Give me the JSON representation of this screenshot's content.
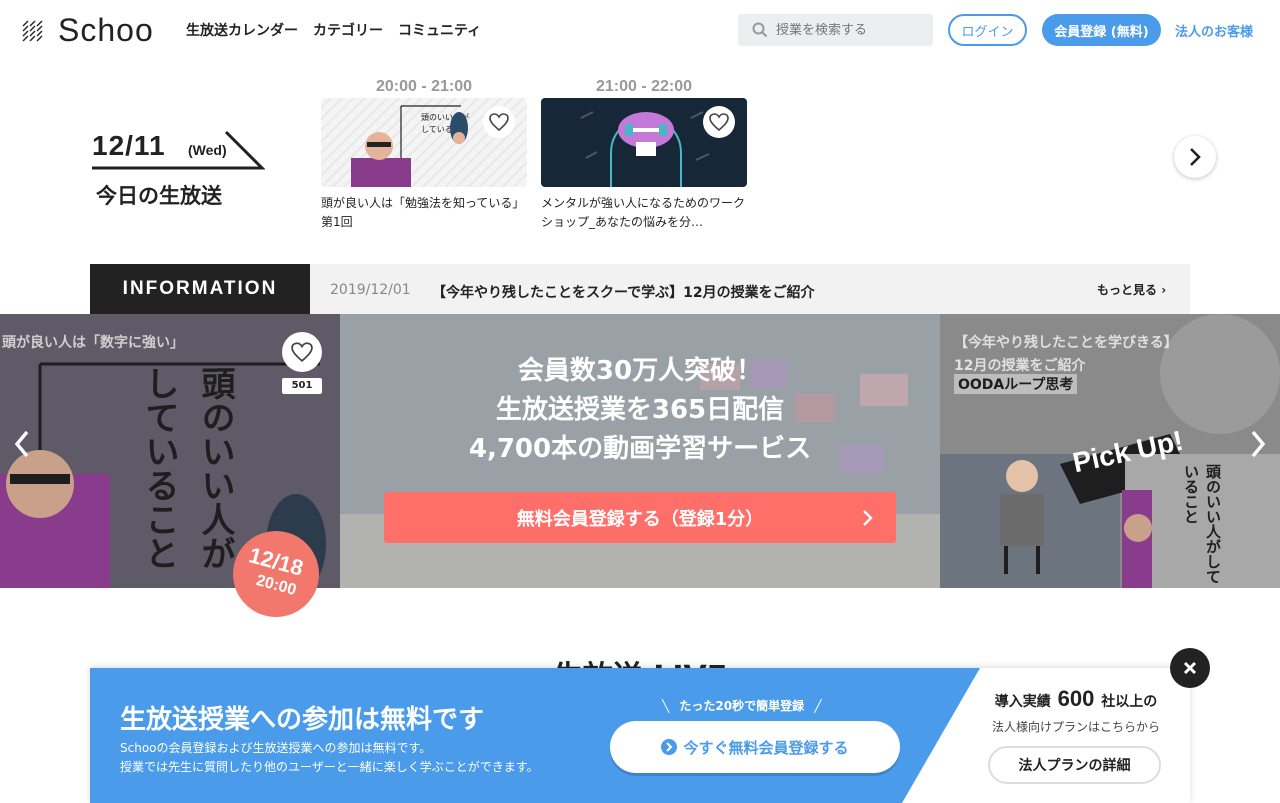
{
  "header": {
    "logo": "Schoo",
    "nav": [
      "生放送カレンダー",
      "カテゴリー",
      "コミュニティ"
    ],
    "search_placeholder": "授業を検索する",
    "login": "ログイン",
    "register": "会員登録 (無料)",
    "corporate": "法人のお客様"
  },
  "today": {
    "date": "12/11",
    "weekday": "(Wed)",
    "label": "今日の生放送"
  },
  "schedule": [
    {
      "time": "20:00 - 21:00",
      "title": "頭が良い人は「勉強法を知っている」 第1回"
    },
    {
      "time": "21:00 - 22:00",
      "title": "メンタルが強い人になるためのワークショップ_あなたの悩みを分…"
    }
  ],
  "information": {
    "label": "INFORMATION",
    "date": "2019/12/01",
    "text": "【今年やり残したことをスクーで学ぶ】12月の授業をご紹介",
    "more": "もっと見る"
  },
  "hero": {
    "left_caption": "頭が良い人は「数字に強い」",
    "left_vertical": "頭のいい人がしていること",
    "like_count": "501",
    "badge_date": "12/18",
    "badge_time": "20:00",
    "copy_line1": "会員数30万人突破！",
    "copy_line2": "生放送授業を365日配信",
    "copy_line3": "4,700本の動画学習サービス",
    "cta": "無料会員登録する（登録1分）",
    "right_line1": "【今年やり残したことを学びきる】",
    "right_line2": "12月の授業をご紹介",
    "right_line3": "OODAループ思考",
    "right_pickup": "Pick Up!",
    "right_vertical": "頭のいい人がしていること"
  },
  "section_heading": "生放送 LIVE",
  "banner": {
    "title": "生放送授業への参加は無料です",
    "desc1": "Schooの会員登録および生放送授業への参加は無料です。",
    "desc2": "授業では先生に質問したり他のユーザーと一緒に楽しく学ぶことができます。",
    "sub": "たった20秒で簡単登録",
    "cta": "今すぐ無料会員登録する",
    "corp_prefix": "導入実績",
    "corp_number": "600",
    "corp_suffix": "社以上の",
    "corp_line2": "法人様向けプランはこちらから",
    "corp_button": "法人プランの詳細"
  },
  "colors": {
    "accent": "#4a9bea",
    "cta": "#ff6f6a",
    "dark": "#222222"
  }
}
